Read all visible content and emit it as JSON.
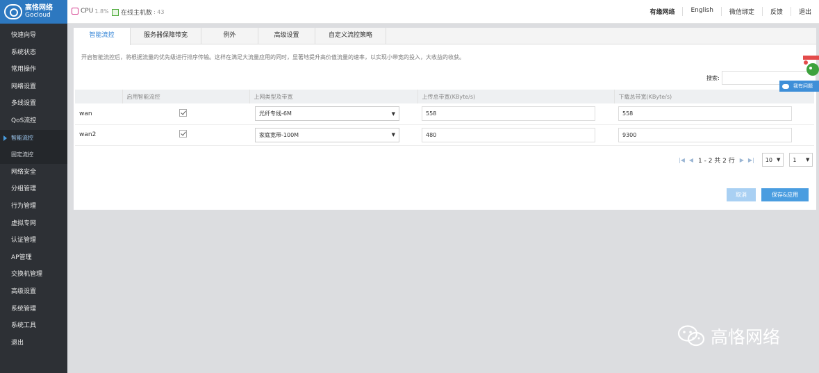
{
  "brand": {
    "name_cn": "高恪网络",
    "name_en": "Gocloud"
  },
  "status": {
    "cpu_label": "CPU",
    "cpu_value": "1.8%",
    "hosts_label": "在线主机数",
    "hosts_value": ": 43"
  },
  "toplinks": [
    "有缘网络",
    "English",
    "微信绑定",
    "反馈",
    "退出"
  ],
  "sidebar": {
    "items": [
      {
        "label": "快速向导"
      },
      {
        "label": "系统状态"
      },
      {
        "label": "常用操作"
      },
      {
        "label": "网络设置"
      },
      {
        "label": "多线设置"
      },
      {
        "label": "QoS流控"
      },
      {
        "label": "智能流控",
        "sub": true,
        "active": true
      },
      {
        "label": "固定流控",
        "sub": true
      },
      {
        "label": "网络安全"
      },
      {
        "label": "分组管理"
      },
      {
        "label": "行为管理"
      },
      {
        "label": "虚拟专网"
      },
      {
        "label": "认证管理"
      },
      {
        "label": "AP管理"
      },
      {
        "label": "交换机管理"
      },
      {
        "label": "高级设置"
      },
      {
        "label": "系统管理"
      },
      {
        "label": "系统工具"
      },
      {
        "label": "退出"
      }
    ]
  },
  "tabs": [
    {
      "label": "智能流控",
      "active": true
    },
    {
      "label": "服务器保障带宽"
    },
    {
      "label": "例外"
    },
    {
      "label": "高级设置"
    },
    {
      "label": "自定义流控策略"
    }
  ],
  "description": "开启智能流控后，将根据流量的优先级进行排序传输。这样在满足大流量应用的同时，显著地提升高价值流量的速率，以实现小带宽的投入，大收益的收获。",
  "search": {
    "label": "搜索:",
    "value": ""
  },
  "table": {
    "headers": [
      "",
      "启用智能流控",
      "上网类型及带宽",
      "上传总带宽(KByte/s)",
      "下载总带宽(KByte/s)"
    ],
    "rows": [
      {
        "name": "wan",
        "enabled": true,
        "type": "光纤专线-6M",
        "upload": "558",
        "download": "558"
      },
      {
        "name": "wan2",
        "enabled": true,
        "type": "家庭宽带-100M",
        "upload": "480",
        "download": "9300"
      }
    ]
  },
  "pager": {
    "info": "1 - 2 共 2 行",
    "page_size": "10",
    "page": "1"
  },
  "actions": {
    "cancel": "取消",
    "save": "保存&应用"
  },
  "float_help": {
    "label": "我有问题"
  },
  "watermark": {
    "text": "高恪网络"
  },
  "colors": {
    "accent": "#4a9de0",
    "sidebar_bg": "#2d3035",
    "logo_bg": "#2d78c0"
  }
}
